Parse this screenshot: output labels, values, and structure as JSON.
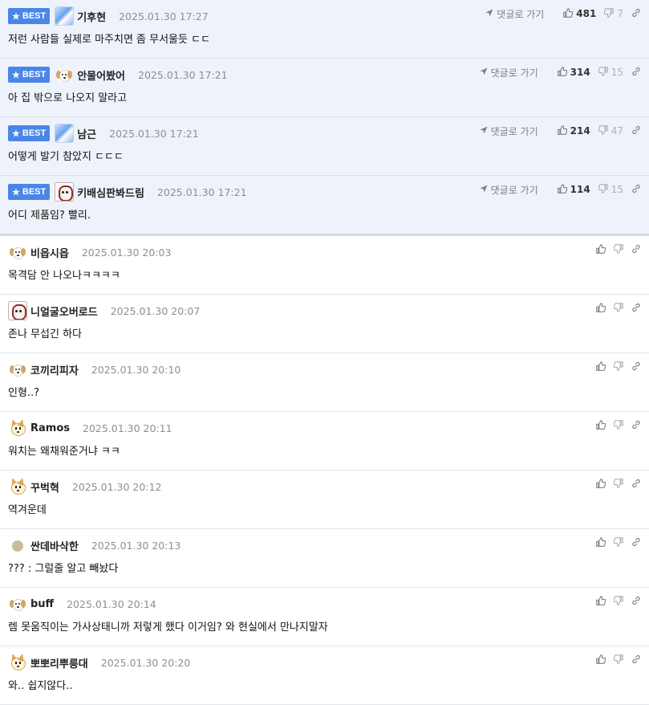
{
  "best_badge": "BEST",
  "goto_label": "댓글로 가기",
  "colors": {
    "best_badge_bg": "#4a86e8",
    "best_row_bg": "#eef3fb"
  },
  "comments": [
    {
      "best": true,
      "avatar": "photo-avatar",
      "nick": "기후현",
      "date": "2025.01.30 17:27",
      "text": "저런 사람들 실제로 마주치면 좀 무서울듯 ㄷㄷ",
      "up": "481",
      "down": "7"
    },
    {
      "best": true,
      "avatar": "dog-avatar",
      "nick": "안물어봤어",
      "date": "2025.01.30 17:21",
      "text": "아 집 밖으로 나오지 말라고",
      "up": "314",
      "down": "15"
    },
    {
      "best": true,
      "avatar": "photo-avatar",
      "nick": "남근",
      "date": "2025.01.30 17:21",
      "text": "어떻게 발기 참았지 ㄷㄷㄷ",
      "up": "214",
      "down": "47"
    },
    {
      "best": true,
      "avatar": "red-avatar",
      "nick": "키배심판봐드림",
      "date": "2025.01.30 17:21",
      "text": "어디 제품임? 빨리.",
      "up": "114",
      "down": "15"
    },
    {
      "best": false,
      "avatar": "dog-avatar",
      "nick": "비읍시읍",
      "date": "2025.01.30 20:03",
      "text": "목격담 안 나오나ㅋㅋㅋㅋ"
    },
    {
      "best": false,
      "avatar": "red-avatar",
      "nick": "니얼굴오버로드",
      "date": "2025.01.30 20:07",
      "text": "존나 무섭긴 하다"
    },
    {
      "best": false,
      "avatar": "dog-avatar",
      "nick": "코끼리피자",
      "date": "2025.01.30 20:10",
      "text": "인형..?"
    },
    {
      "best": false,
      "avatar": "fox-avatar",
      "nick": "Ramos",
      "date": "2025.01.30 20:11",
      "text": "워치는 왜채워준거냐 ㅋㅋ"
    },
    {
      "best": false,
      "avatar": "fox-avatar",
      "nick": "꾸벅혁",
      "date": "2025.01.30 20:12",
      "text": "역겨운데"
    },
    {
      "best": false,
      "avatar": "ball-avatar",
      "nick": "싼데바삭한",
      "date": "2025.01.30 20:13",
      "text": "??? : 그럴줄 알고 빼놨다"
    },
    {
      "best": false,
      "avatar": "dog-avatar",
      "nick": "buff",
      "date": "2025.01.30 20:14",
      "text": "렘 못움직이는 가사상태니까 저렇게 했다 이거임? 와 현실에서 만나지말자"
    },
    {
      "best": false,
      "avatar": "fox-avatar",
      "nick": "뽀뽀리뿌릉대",
      "date": "2025.01.30 20:20",
      "text": "와.. 쉽지않다.."
    }
  ]
}
